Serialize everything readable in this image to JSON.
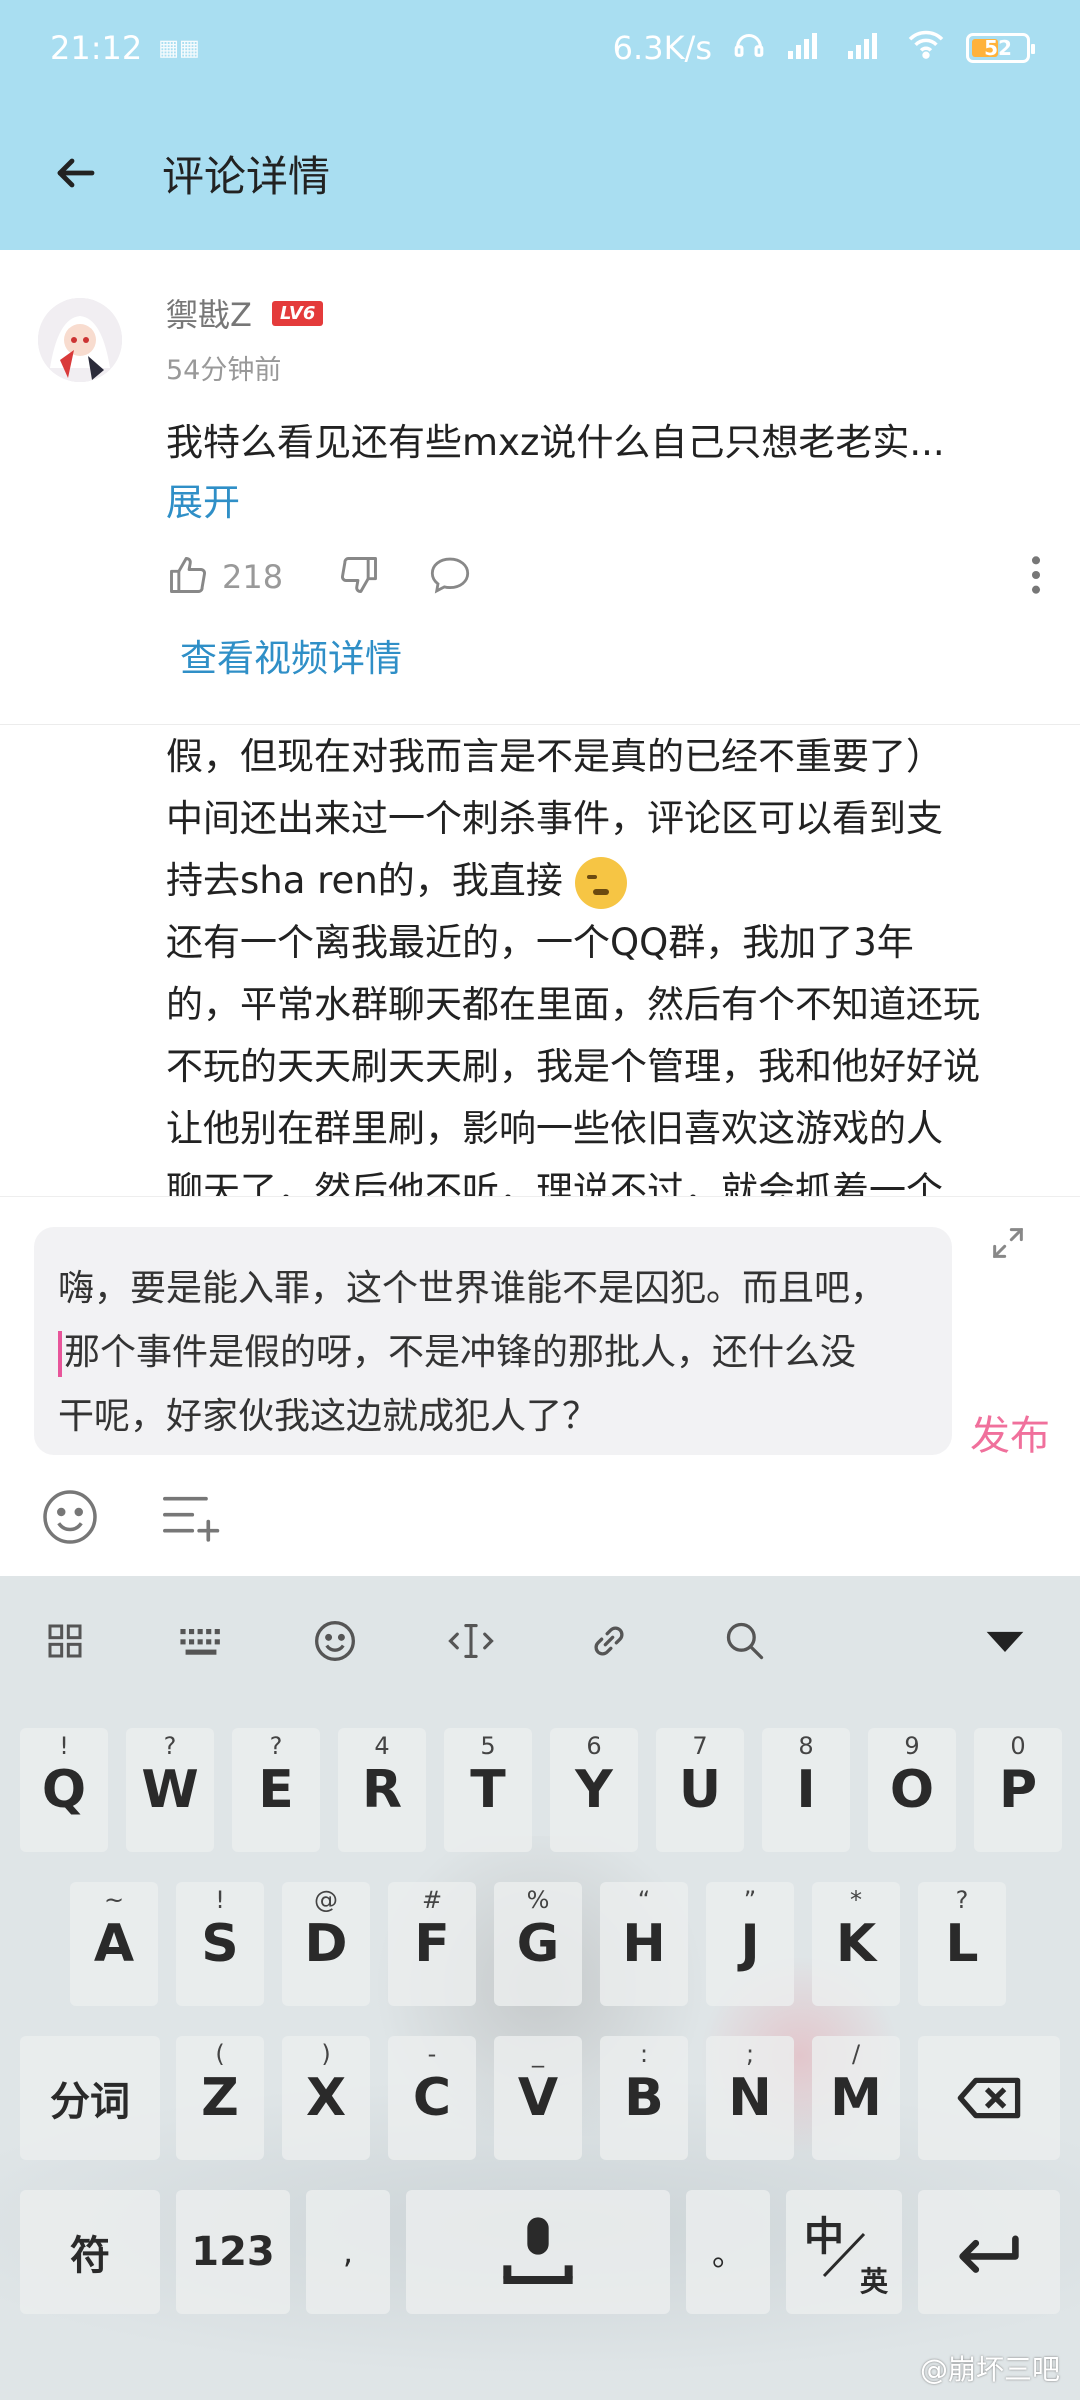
{
  "status": {
    "time": "21:12",
    "speed": "6.3K/s",
    "battery": "52"
  },
  "appbar": {
    "title": "评论详情"
  },
  "comment": {
    "username": "禦戡Z",
    "level": "LV6",
    "time": "54分钟前",
    "text": "我特么看见还有些mxz说什么自己只想老老实...",
    "expand": "展开",
    "likes": "218",
    "video_link": "查看视频详情"
  },
  "reply_lines": [
    "假，但现在对我而言是不是真的已经不重要了）",
    "中间还出来过一个刺杀事件，评论区可以看到支",
    "持去sha ren的，我直接",
    "还有一个离我最近的，一个QQ群，我加了3年",
    "的，平常水群聊天都在里面，然后有个不知道还玩",
    "不玩的天天刷天天刷，我是个管理，我和他好好说",
    "让他别在群里刷，影响一些依旧喜欢这游戏的人",
    "聊天了，然后他不听，理说不过，就会抓着一个"
  ],
  "input": {
    "line1": "嗨，要是能入罪，这个世界谁能不是囚犯。而且吧，",
    "line2": "那个事件是假的呀，不是冲锋的那批人，还什么没",
    "line3": "干呢，好家伙我这边就成犯人了？",
    "publish": "发布"
  },
  "keyboard": {
    "row1": [
      {
        "k": "Q",
        "s": "!"
      },
      {
        "k": "W",
        "s": "?"
      },
      {
        "k": "E",
        "s": "?"
      },
      {
        "k": "R",
        "s": "4"
      },
      {
        "k": "T",
        "s": "5"
      },
      {
        "k": "Y",
        "s": "6"
      },
      {
        "k": "U",
        "s": "7"
      },
      {
        "k": "I",
        "s": "8"
      },
      {
        "k": "O",
        "s": "9"
      },
      {
        "k": "P",
        "s": "0"
      }
    ],
    "row2": [
      {
        "k": "A",
        "s": "~"
      },
      {
        "k": "S",
        "s": "!"
      },
      {
        "k": "D",
        "s": "@"
      },
      {
        "k": "F",
        "s": "#"
      },
      {
        "k": "G",
        "s": "%"
      },
      {
        "k": "H",
        "s": "“"
      },
      {
        "k": "J",
        "s": "”"
      },
      {
        "k": "K",
        "s": "*"
      },
      {
        "k": "L",
        "s": "?"
      }
    ],
    "row3": [
      {
        "k": "Z",
        "s": "("
      },
      {
        "k": "X",
        "s": ")"
      },
      {
        "k": "C",
        "s": "-"
      },
      {
        "k": "V",
        "s": "_"
      },
      {
        "k": "B",
        "s": ":"
      },
      {
        "k": "N",
        "s": ";"
      },
      {
        "k": "M",
        "s": "/"
      }
    ],
    "segment": "分词",
    "symbols": "符",
    "num": "123",
    "comma": ",",
    "period": "。",
    "lang_cn": "中",
    "lang_en": "英"
  },
  "watermark": "@崩坏三吧"
}
